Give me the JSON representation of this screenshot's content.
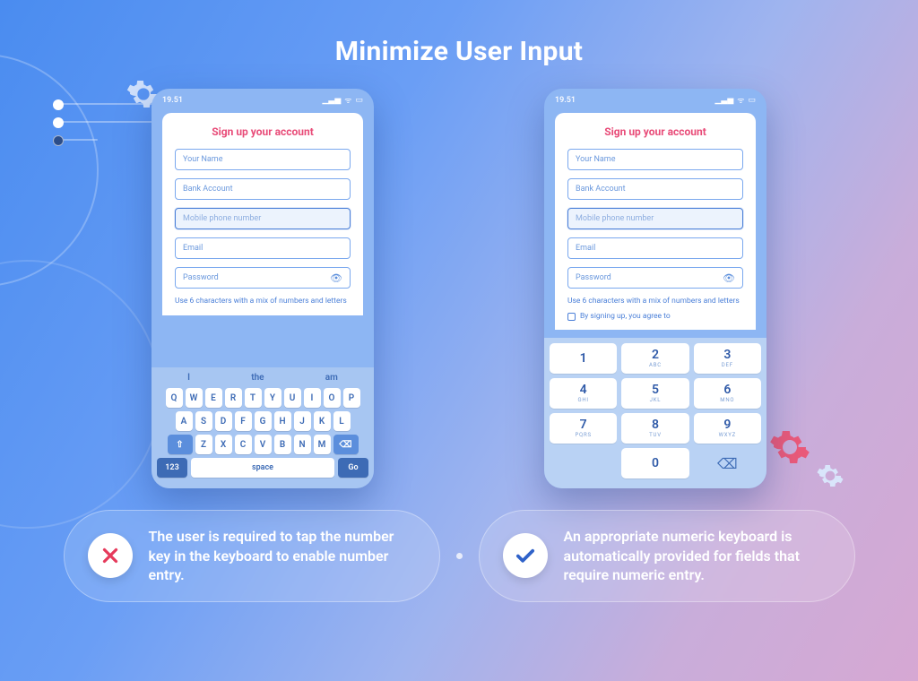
{
  "title": "Minimize User Input",
  "phone": {
    "time": "19.51",
    "form_title": "Sign up your account",
    "fields": {
      "name": "Your Name",
      "bank": "Bank Account",
      "phone": "Mobile phone number",
      "email": "Email",
      "password": "Password"
    },
    "hint": "Use 6 characters with a mix of numbers and letters",
    "agree": "By signing up, you agree to"
  },
  "qwerty": {
    "suggestions": [
      "I",
      "the",
      "am"
    ],
    "row1": [
      "Q",
      "W",
      "E",
      "R",
      "T",
      "Y",
      "U",
      "I",
      "O",
      "P"
    ],
    "row2": [
      "A",
      "S",
      "D",
      "F",
      "G",
      "H",
      "J",
      "K",
      "L"
    ],
    "row3": [
      "Z",
      "X",
      "C",
      "V",
      "B",
      "N",
      "M"
    ],
    "num_key": "123",
    "space_key": "space",
    "go_key": "Go"
  },
  "numpad": {
    "keys": [
      {
        "n": "1",
        "s": ""
      },
      {
        "n": "2",
        "s": "ABC"
      },
      {
        "n": "3",
        "s": "DEF"
      },
      {
        "n": "4",
        "s": "GHI"
      },
      {
        "n": "5",
        "s": "JKL"
      },
      {
        "n": "6",
        "s": "MNO"
      },
      {
        "n": "7",
        "s": "PQRS"
      },
      {
        "n": "8",
        "s": "TUV"
      },
      {
        "n": "9",
        "s": "WXYZ"
      },
      {
        "n": "",
        "s": ""
      },
      {
        "n": "0",
        "s": ""
      },
      {
        "n": "⌫",
        "s": ""
      }
    ]
  },
  "captions": {
    "bad": "The user is required to tap the number key in the keyboard to enable number entry.",
    "good": "An appropriate numeric keyboard is automatically provided for fields that require numeric entry."
  }
}
